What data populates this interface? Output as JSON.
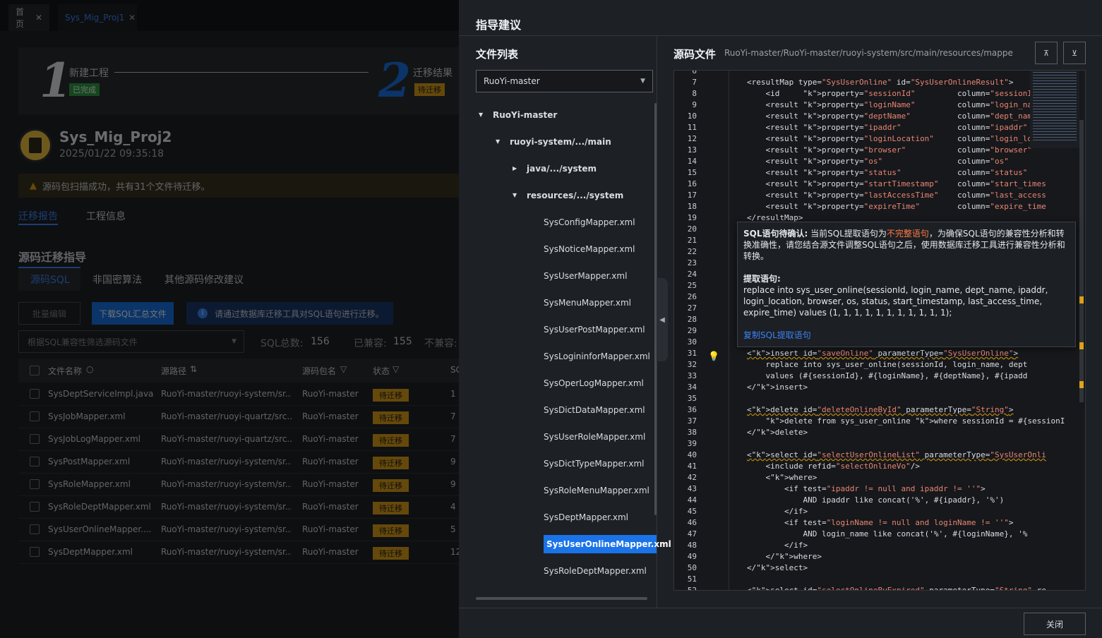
{
  "tabs": [
    "首页",
    "Sys_Mig_Proj1"
  ],
  "steps": {
    "s1_num": "1",
    "s1_label": "新建工程",
    "s1_badge": "已完成",
    "s2_num": "2",
    "s2_label": "迁移结果",
    "s2_badge": "待迁移"
  },
  "project": {
    "name": "Sys_Mig_Proj2",
    "date": "2025/01/22 09:35:18"
  },
  "warning": "源码包扫描成功，共有31个文件待迁移。",
  "main_tabs": [
    "迁移报告",
    "工程信息"
  ],
  "section_title": "源码迁移指导",
  "sub_tabs": [
    "源码SQL",
    "非国密算法",
    "其他源码修改建议"
  ],
  "toolbar": {
    "batch": "批量编辑",
    "download": "下载SQL汇总文件",
    "info": "请通过数据库迁移工具对SQL语句进行迁移。"
  },
  "filter": {
    "placeholder": "根据SQL兼容性筛选源码文件",
    "total_label": "SQL总数:",
    "total": "156",
    "compat_label": "已兼容:",
    "compat": "155",
    "incompat_label": "不兼容:"
  },
  "table": {
    "headers": [
      "文件名称",
      "源路径",
      "源码包名",
      "状态",
      "SC"
    ],
    "rows": [
      [
        "SysDeptServiceImpl.java",
        "RuoYi-master/ruoyi-system/sr...",
        "RuoYi-master",
        "待迁移",
        "1"
      ],
      [
        "SysJobMapper.xml",
        "RuoYi-master/ruoyi-quartz/src...",
        "RuoYi-master",
        "待迁移",
        "7"
      ],
      [
        "SysJobLogMapper.xml",
        "RuoYi-master/ruoyi-quartz/src...",
        "RuoYi-master",
        "待迁移",
        "7"
      ],
      [
        "SysPostMapper.xml",
        "RuoYi-master/ruoyi-system/sr...",
        "RuoYi-master",
        "待迁移",
        "9"
      ],
      [
        "SysRoleMapper.xml",
        "RuoYi-master/ruoyi-system/sr...",
        "RuoYi-master",
        "待迁移",
        "9"
      ],
      [
        "SysRoleDeptMapper.xml",
        "RuoYi-master/ruoyi-system/sr...",
        "RuoYi-master",
        "待迁移",
        "4"
      ],
      [
        "SysUserOnlineMapper....",
        "RuoYi-master/ruoyi-system/sr...",
        "RuoYi-master",
        "待迁移",
        "5"
      ],
      [
        "SysDeptMapper.xml",
        "RuoYi-master/ruoyi-system/sr...",
        "RuoYi-master",
        "待迁移",
        "12"
      ]
    ]
  },
  "panel": {
    "title": "指导建议",
    "file_list_title": "文件列表",
    "select_value": "RuoYi-master",
    "source_title": "源码文件",
    "source_path": "RuoYi-master/RuoYi-master/ruoyi-system/src/main/resources/mapper/s...",
    "close": "关闭"
  },
  "tree": {
    "root": "RuoYi-master",
    "l1": "ruoyi-system/.../main",
    "l2a": "java/.../system",
    "l2b": "resources/.../system",
    "files": [
      "SysConfigMapper.xml",
      "SysNoticeMapper.xml",
      "SysUserMapper.xml",
      "SysMenuMapper.xml",
      "SysUserPostMapper.xml",
      "SysLogininforMapper.xml",
      "SysOperLogMapper.xml",
      "SysDictDataMapper.xml",
      "SysUserRoleMapper.xml",
      "SysDictTypeMapper.xml",
      "SysRoleMenuMapper.xml",
      "SysDeptMapper.xml",
      "SysUserOnlineMapper.xml",
      "SysRoleDeptMapper.xml"
    ]
  },
  "line_numbers": [
    "6",
    "7",
    "8",
    "9",
    "10",
    "11",
    "12",
    "13",
    "14",
    "15",
    "16",
    "17",
    "18",
    "19",
    "20",
    "21",
    "22",
    "23",
    "24",
    "25",
    "26",
    "27",
    "28",
    "29",
    "30",
    "31",
    "32",
    "33",
    "34",
    "35",
    "36",
    "37",
    "38",
    "39",
    "40",
    "41",
    "42",
    "43",
    "44",
    "45",
    "46",
    "47",
    "48",
    "49",
    "50",
    "51",
    "52"
  ],
  "code_lines": [
    {
      "line": "7",
      "text": "<resultMap type=\"SysUserOnline\" id=\"SysUserOnlineResult\">"
    },
    {
      "line": "8",
      "text": "    <id     property=\"sessionId\"         column=\"sessionId\""
    },
    {
      "line": "9",
      "text": "    <result property=\"loginName\"         column=\"login_name\""
    },
    {
      "line": "10",
      "text": "    <result property=\"deptName\"          column=\"dept_name\""
    },
    {
      "line": "11",
      "text": "    <result property=\"ipaddr\"            column=\"ipaddr\""
    },
    {
      "line": "12",
      "text": "    <result property=\"loginLocation\"     column=\"login_locat"
    },
    {
      "line": "13",
      "text": "    <result property=\"browser\"           column=\"browser\""
    },
    {
      "line": "14",
      "text": "    <result property=\"os\"                column=\"os\""
    },
    {
      "line": "15",
      "text": "    <result property=\"status\"            column=\"status\""
    },
    {
      "line": "16",
      "text": "    <result property=\"startTimestamp\"    column=\"start_times"
    },
    {
      "line": "17",
      "text": "    <result property=\"lastAccessTime\"    column=\"last_access"
    },
    {
      "line": "18",
      "text": "    <result property=\"expireTime\"        column=\"expire_time"
    },
    {
      "line": "19",
      "text": "</resultMap>"
    },
    {
      "line": "31",
      "text": "<insert id=\"saveOnline\" parameterType=\"SysUserOnline\">"
    },
    {
      "line": "32",
      "text": "    replace into sys_user_online(sessionId, login_name, dept"
    },
    {
      "line": "33",
      "text": "    values (#{sessionId}, #{loginName}, #{deptName}, #{ipadd"
    },
    {
      "line": "34",
      "text": "</insert>"
    },
    {
      "line": "36",
      "text": "<delete id=\"deleteOnlineById\" parameterType=\"String\">"
    },
    {
      "line": "37",
      "text": "    delete from sys_user_online where sessionId = #{sessionI"
    },
    {
      "line": "38",
      "text": "</delete>"
    },
    {
      "line": "40",
      "text": "<select id=\"selectUserOnlineList\" parameterType=\"SysUserOnli"
    },
    {
      "line": "41",
      "text": "    <include refid=\"selectOnlineVo\"/>"
    },
    {
      "line": "42",
      "text": "    <where>"
    },
    {
      "line": "43",
      "text": "        <if test=\"ipaddr != null and ipaddr != ''\">"
    },
    {
      "line": "44",
      "text": "            AND ipaddr like concat('%', #{ipaddr}, '%')"
    },
    {
      "line": "45",
      "text": "        </if>"
    },
    {
      "line": "46",
      "text": "        <if test=\"loginName != null and loginName != ''\">"
    },
    {
      "line": "47",
      "text": "            AND login_name like concat('%', #{loginName}, '%"
    },
    {
      "line": "48",
      "text": "        </if>"
    },
    {
      "line": "49",
      "text": "    </where>"
    },
    {
      "line": "50",
      "text": "</select>"
    },
    {
      "line": "52",
      "text": "<select id=\"selectOnlineByExpired\" parameterType=\"String\" re"
    }
  ],
  "tooltip": {
    "title": "SQL语句待确认:",
    "msg_a": "当前SQL提取语句为",
    "msg_hl": "不完整语句",
    "msg_b": "，为确保SQL语句的兼容性分析和转换准确性，请您结合源文件调整SQL语句之后，使用数据库迁移工具进行兼容性分析和转换。",
    "extract_title": "提取语句:",
    "extract_sql": "replace into sys_user_online(sessionId, login_name, dept_name, ipaddr, login_location, browser, os, status, start_timestamp, last_access_time, expire_time) values (1, 1, 1, 1, 1, 1, 1, 1, 1, 1, 1);",
    "copy": "复制SQL提取语句"
  },
  "colors": {
    "accent": "#1a73e8",
    "warn": "#e0a31a",
    "link": "#3b82f6",
    "highlight": "#ff7a45"
  }
}
